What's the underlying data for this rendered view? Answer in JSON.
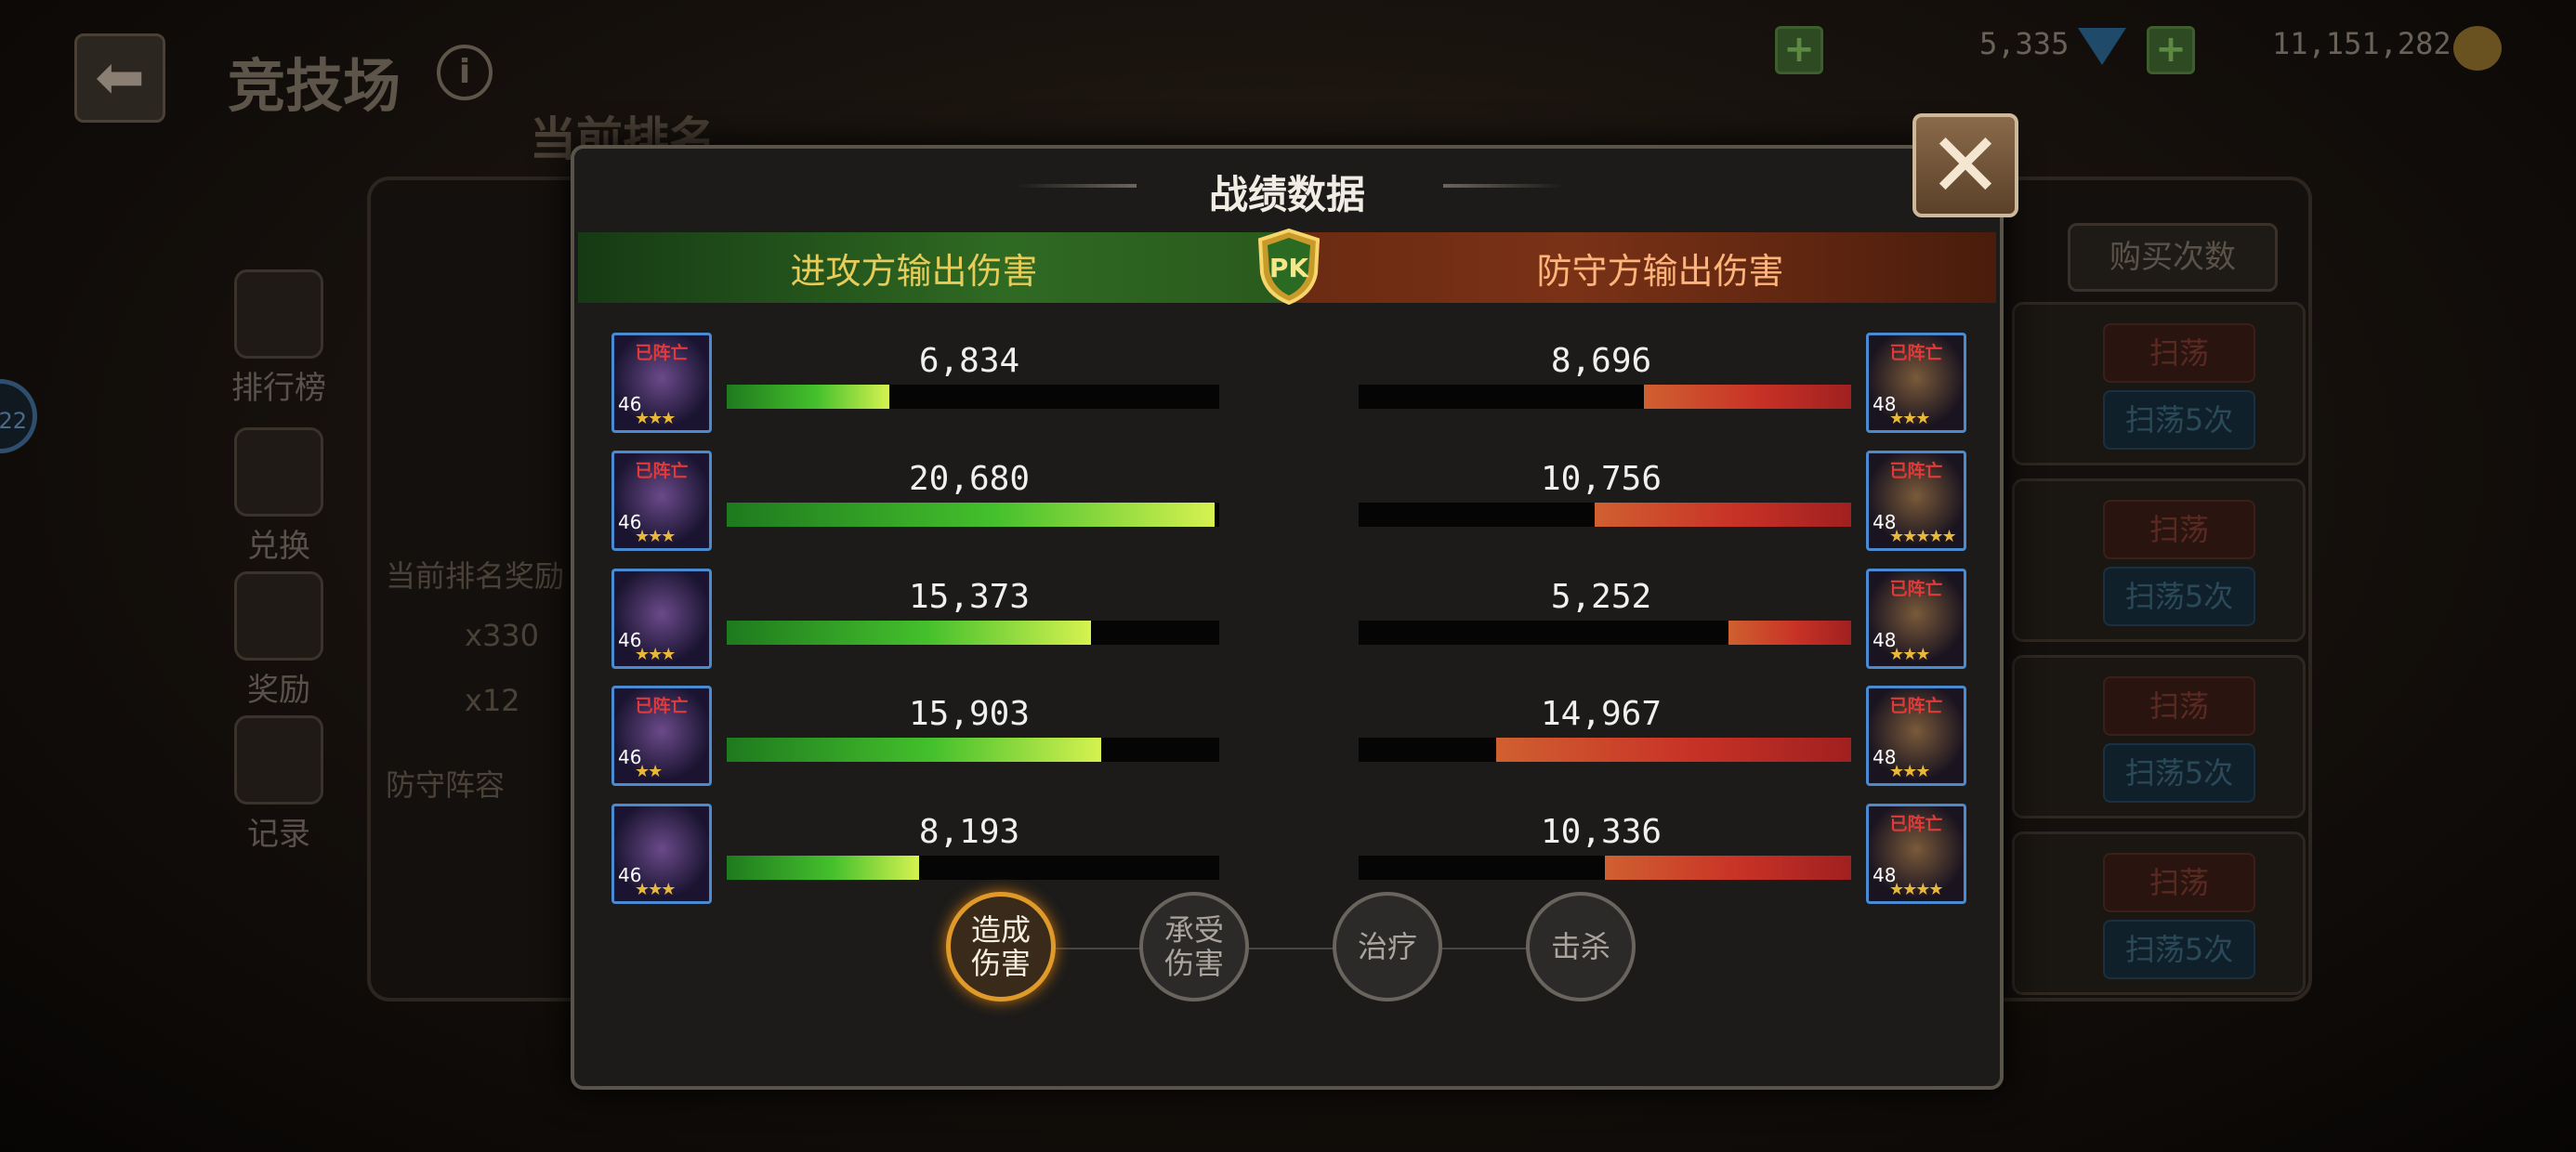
{
  "header": {
    "title": "竞技场",
    "rank_label": "当前排名",
    "gems": "5,335",
    "gold": "11,151,282"
  },
  "side_nav": [
    {
      "label": "排行榜"
    },
    {
      "label": "兑换"
    },
    {
      "label": "奖励"
    },
    {
      "label": "记录"
    }
  ],
  "background": {
    "reward_label": "当前排名奖励",
    "gem_count": "x330",
    "item_count": "x12",
    "defense_label": "防守阵容",
    "buy_label": "购买次数",
    "sweep_label": "扫荡",
    "sweep5_label": "扫荡5次",
    "badge_text": "22"
  },
  "modal": {
    "title": "战绩数据",
    "attacker_header": "进攻方输出伤害",
    "defender_header": "防守方输出伤害",
    "pk_label": "PK",
    "dead_label": "已阵亡"
  },
  "attackers": [
    {
      "level": "46",
      "stars": "★★★",
      "dead": true,
      "value_text": "6,834",
      "value": 6834,
      "pct": 0.33
    },
    {
      "level": "46",
      "stars": "★★★",
      "dead": true,
      "value_text": "20,680",
      "value": 20680,
      "pct": 0.99
    },
    {
      "level": "46",
      "stars": "★★★",
      "dead": false,
      "value_text": "15,373",
      "value": 15373,
      "pct": 0.74
    },
    {
      "level": "46",
      "stars": "★★",
      "dead": true,
      "value_text": "15,903",
      "value": 15903,
      "pct": 0.76
    },
    {
      "level": "46",
      "stars": "★★★",
      "dead": false,
      "value_text": "8,193",
      "value": 8193,
      "pct": 0.39
    }
  ],
  "defenders": [
    {
      "level": "48",
      "stars": "★★★",
      "dead": true,
      "value_text": "8,696",
      "value": 8696,
      "pct": 0.42
    },
    {
      "level": "48",
      "stars": "★★★★★",
      "dead": true,
      "value_text": "10,756",
      "value": 10756,
      "pct": 0.52
    },
    {
      "level": "48",
      "stars": "★★★",
      "dead": true,
      "value_text": "5,252",
      "value": 5252,
      "pct": 0.25
    },
    {
      "level": "48",
      "stars": "★★★",
      "dead": true,
      "value_text": "14,967",
      "value": 14967,
      "pct": 0.72
    },
    {
      "level": "48",
      "stars": "★★★★",
      "dead": true,
      "value_text": "10,336",
      "value": 10336,
      "pct": 0.5
    }
  ],
  "tabs": [
    {
      "label": "造成\n伤害",
      "active": true
    },
    {
      "label": "承受\n伤害",
      "active": false
    },
    {
      "label": "治疗",
      "active": false
    },
    {
      "label": "击杀",
      "active": false
    }
  ],
  "colors": {
    "attacker_bar": "#44c02c",
    "defender_bar": "#c83226",
    "active_tab": "#e09a2a",
    "avatar_border": "#4a8ad0"
  }
}
